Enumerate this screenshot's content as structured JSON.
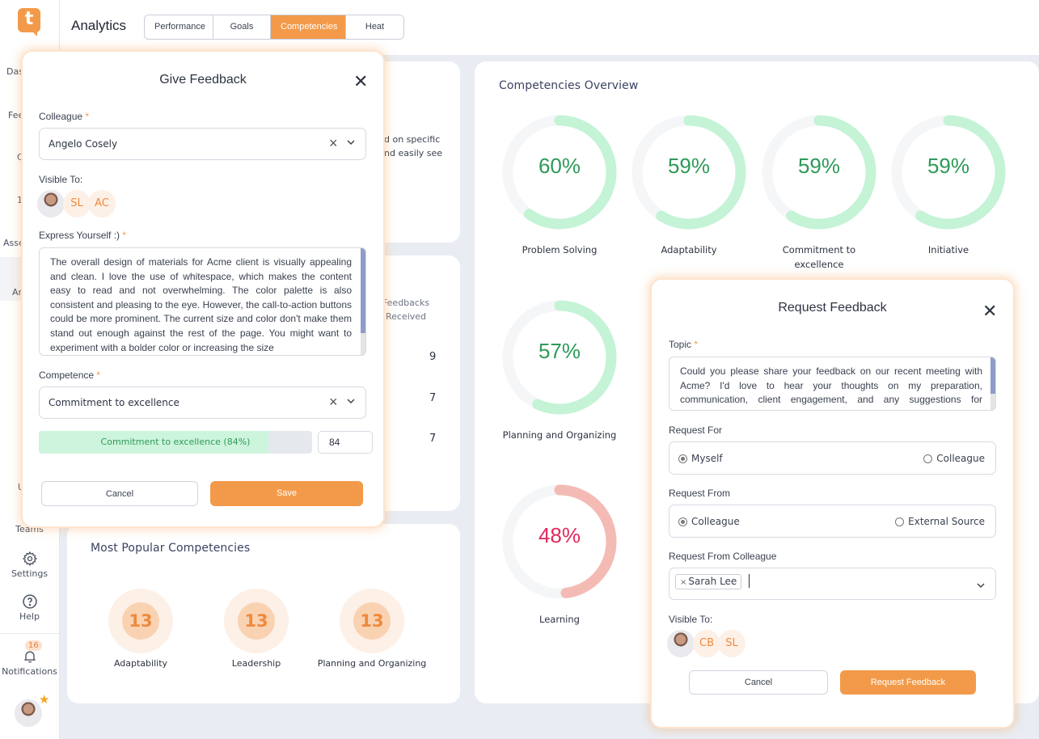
{
  "app": {
    "logo_letter": "t",
    "page_title": "Analytics"
  },
  "sidebar": {
    "items": [
      {
        "label": "Dashboard",
        "visible": "Das"
      },
      {
        "label": "Feedback",
        "visible": "Fee"
      },
      {
        "label": "C",
        "visible": "C"
      },
      {
        "label": "1",
        "visible": "1"
      },
      {
        "label": "Assessments",
        "visible": "Asse"
      },
      {
        "label": "Analytics",
        "visible": "An",
        "active": true
      },
      {
        "label": "U",
        "visible": "U"
      },
      {
        "label": "Teams",
        "visible": "Teams"
      },
      {
        "label": "Settings",
        "visible": "Settings",
        "icon": "gear-icon"
      },
      {
        "label": "Help",
        "visible": "Help",
        "icon": "help-icon"
      },
      {
        "label": "Notifications",
        "visible": "Notifications",
        "icon": "bell-icon",
        "badge": "16"
      }
    ]
  },
  "tabs": [
    {
      "label": "Performance",
      "active": false
    },
    {
      "label": "Goals",
      "active": false
    },
    {
      "label": "Competencies",
      "active": true
    },
    {
      "label": "Heat Map",
      "active": false
    }
  ],
  "background_cards": {
    "intro_partial_lines": [
      "d on specific",
      "nd easily see"
    ],
    "table": {
      "column_header_line1": "Feedbacks",
      "column_header_line2": "Received",
      "values": [
        "9",
        "7",
        "7"
      ]
    },
    "most_popular": {
      "title": "Most Popular Competencies",
      "items": [
        {
          "count": "13",
          "label": "Adaptability"
        },
        {
          "count": "13",
          "label": "Leadership"
        },
        {
          "count": "13",
          "label": "Planning and Organizing"
        }
      ]
    }
  },
  "chart_data": {
    "type": "donut-grid",
    "title": "Competencies Overview",
    "items": [
      {
        "label": "Problem Solving",
        "value": 60,
        "status": "good"
      },
      {
        "label": "Adaptability",
        "value": 59,
        "status": "good"
      },
      {
        "label": "Commitment to excellence",
        "value": 59,
        "status": "good"
      },
      {
        "label": "Initiative",
        "value": 59,
        "status": "good"
      },
      {
        "label": "Planning and Organizing",
        "value": 57,
        "status": "good"
      },
      {
        "label": "Learning",
        "value": 48,
        "status": "bad"
      }
    ],
    "colors": {
      "good_arc": "#c4f3d6",
      "good_text": "#2e9a58",
      "bad_arc": "#f4bbb5",
      "bad_text": "#e2295a",
      "track": "#f5f6f8"
    }
  },
  "give_feedback": {
    "title": "Give Feedback",
    "colleague_label": "Colleague",
    "colleague_value": "Angelo Cosely",
    "visible_to_label": "Visible To:",
    "visible_to": [
      "SL",
      "AC"
    ],
    "express_label": "Express Yourself :)",
    "express_text": "The overall design of materials for Acme client is visually appealing and clean. I love the use of whitespace, which makes the content easy to read and not overwhelming. The color palette is also consistent and pleasing to the eye. However, the call-to-action buttons could be more prominent. The current size and color don't make them stand out enough against the rest of the page. You might want to experiment with a bolder color or increasing the size",
    "competence_label": "Competence",
    "competence_value": "Commitment to excellence",
    "rating_text": "Commitment to excellence (84%)",
    "rating_value": 84,
    "rating_input": "84",
    "cancel_label": "Cancel",
    "save_label": "Save"
  },
  "request_feedback": {
    "title": "Request Feedback",
    "topic_label": "Topic",
    "topic_text": "Could you please share your feedback on our recent meeting with Acme? I'd love to hear your thoughts on my preparation, communication, client engagement, and any suggestions for improvement.",
    "request_for_label": "Request For",
    "request_for_options": [
      {
        "label": "Myself",
        "checked": true
      },
      {
        "label": "Colleague",
        "checked": false
      }
    ],
    "request_from_label": "Request From",
    "request_from_options": [
      {
        "label": "Colleague",
        "checked": true
      },
      {
        "label": "External Source",
        "checked": false
      }
    ],
    "request_from_colleague_label": "Request From Colleague",
    "selected_colleagues": [
      "Sarah Lee"
    ],
    "visible_to_label": "Visible To:",
    "visible_to": [
      "CB",
      "SL"
    ],
    "cancel_label": "Cancel",
    "submit_label": "Request Feedback"
  },
  "colors": {
    "accent": "#f39a4a",
    "background": "#e9edf3"
  }
}
